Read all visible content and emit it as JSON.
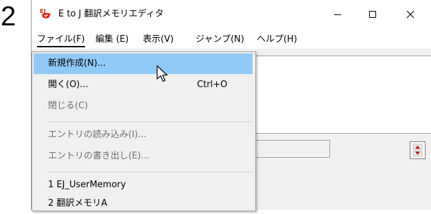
{
  "step_number": "2",
  "window": {
    "title": "E to J 翻訳メモリエディタ",
    "icon": "ej-app-icon",
    "controls": {
      "minimize": "minimize-icon",
      "maximize": "maximize-icon",
      "close": "close-icon"
    }
  },
  "menubar": {
    "items": [
      {
        "label": "ファイル(F)",
        "active": true
      },
      {
        "label": "編集 (E)"
      },
      {
        "label": "表示(V)"
      },
      {
        "label": "ジャンプ(N)"
      },
      {
        "label": "ヘルプ(H)"
      }
    ]
  },
  "file_menu": {
    "items": [
      {
        "label": "新規作成(N)...",
        "shortcut": "",
        "highlighted": true,
        "enabled": true
      },
      {
        "label": "開く(O)...",
        "shortcut": "Ctrl+O",
        "enabled": true
      },
      {
        "label": "閉じる(C)",
        "shortcut": "",
        "enabled": false
      },
      {
        "label": "エントリの読み込み(I)...",
        "shortcut": "",
        "enabled": false
      },
      {
        "label": "エントリの書き出し(E)...",
        "shortcut": "",
        "enabled": false
      },
      {
        "label": "1 EJ_UserMemory",
        "shortcut": "",
        "enabled": true
      },
      {
        "label": "2 翻訳メモリA",
        "shortcut": "",
        "enabled": true
      }
    ]
  },
  "colors": {
    "highlight": "#91c9f7",
    "menu_background": "#f0f0f0",
    "disabled_text": "#6d6d6d",
    "icon_red": "#d9261c"
  }
}
